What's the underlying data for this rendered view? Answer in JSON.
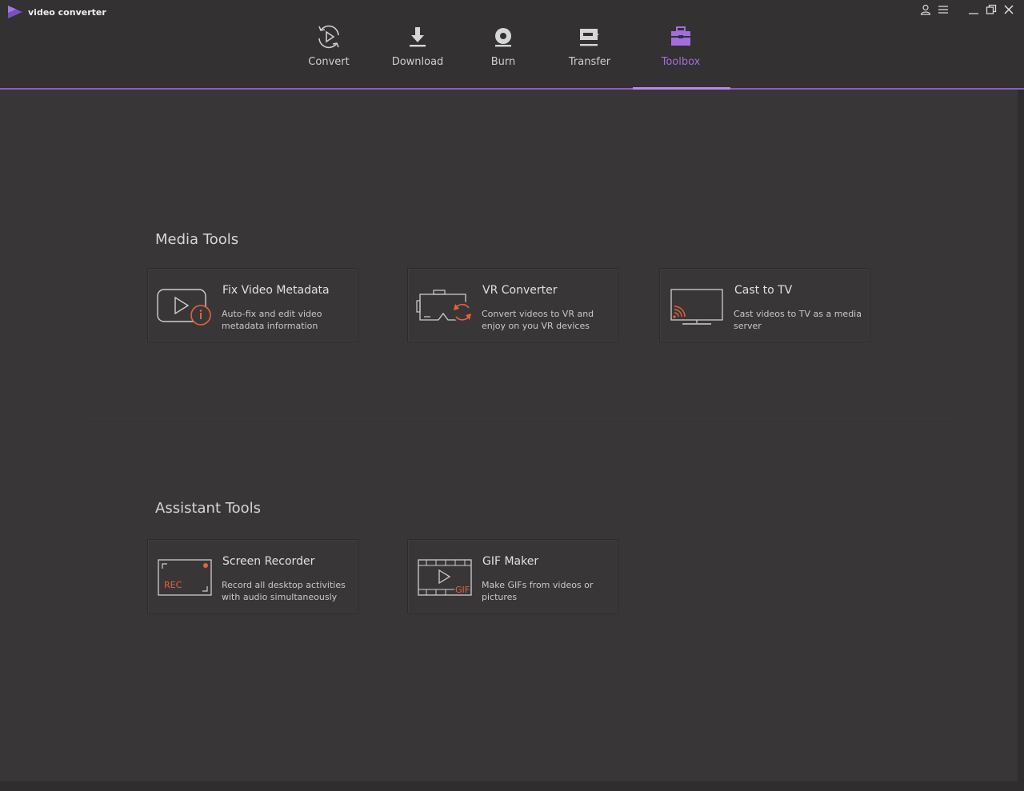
{
  "app": {
    "title": "video converter",
    "accent_color": "#8b5cc7",
    "highlight_color": "#e8603c"
  },
  "window_controls": [
    {
      "name": "account-icon"
    },
    {
      "name": "menu-icon"
    },
    {
      "name": "minimize-icon"
    },
    {
      "name": "restore-icon"
    },
    {
      "name": "close-icon"
    }
  ],
  "tabs": [
    {
      "label": "Convert",
      "icon": "convert-icon",
      "active": false
    },
    {
      "label": "Download",
      "icon": "download-icon",
      "active": false
    },
    {
      "label": "Burn",
      "icon": "disc-icon",
      "active": false
    },
    {
      "label": "Transfer",
      "icon": "transfer-icon",
      "active": false
    },
    {
      "label": "Toolbox",
      "icon": "toolbox-icon",
      "active": true
    }
  ],
  "sections": [
    {
      "title": "Media Tools",
      "cards": [
        {
          "title": "Fix Video Metadata",
          "desc": "Auto-fix and edit video metadata information",
          "icon": "video-info-icon"
        },
        {
          "title": "VR Converter",
          "desc": "Convert videos to VR and enjoy on you VR devices",
          "icon": "vr-headset-icon"
        },
        {
          "title": "Cast to TV",
          "desc": "Cast videos to TV as a media server",
          "icon": "cast-tv-icon"
        }
      ]
    },
    {
      "title": "Assistant Tools",
      "cards": [
        {
          "title": "Screen Recorder",
          "desc": "Record all desktop activities with audio simultaneously",
          "icon": "screen-record-icon",
          "icon_text": "REC"
        },
        {
          "title": "GIF Maker",
          "desc": "Make GIFs from videos or pictures",
          "icon": "gif-film-icon",
          "icon_text": "GIF"
        }
      ]
    }
  ]
}
